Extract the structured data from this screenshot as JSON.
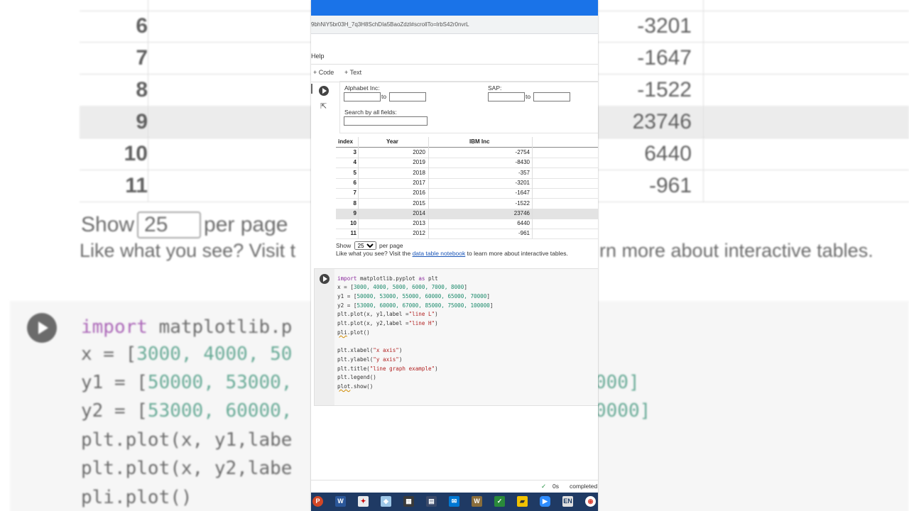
{
  "browser": {
    "url": "9bhNiY5br03H_7q3H8SchDIa5BaoZdzl#scrollTo=lrbS42r0nvrL"
  },
  "menu": {
    "help": "Help"
  },
  "toolbar": {
    "code_label": "+ Code",
    "text_label": "+ Text"
  },
  "filters": {
    "alphabet_label": "Alphabet Inc:",
    "sap_label": "SAP:",
    "to_label": "to",
    "search_label": "Search by all fields:",
    "alphabet_from": "",
    "alphabet_to": "",
    "sap_from": "",
    "sap_to": "",
    "search_value": ""
  },
  "table": {
    "headers": [
      "index",
      "Year",
      "IBM Inc"
    ],
    "rows": [
      {
        "index": "3",
        "year": "2020",
        "ibm": "-2754"
      },
      {
        "index": "4",
        "year": "2019",
        "ibm": "-8430"
      },
      {
        "index": "5",
        "year": "2018",
        "ibm": "-357"
      },
      {
        "index": "6",
        "year": "2017",
        "ibm": "-3201"
      },
      {
        "index": "7",
        "year": "2016",
        "ibm": "-1647"
      },
      {
        "index": "8",
        "year": "2015",
        "ibm": "-1522"
      },
      {
        "index": "9",
        "year": "2014",
        "ibm": "23746"
      },
      {
        "index": "10",
        "year": "2013",
        "ibm": "6440"
      },
      {
        "index": "11",
        "year": "2012",
        "ibm": "-961"
      }
    ]
  },
  "pagination": {
    "show": "Show",
    "per_page_value": "25",
    "per_page": "per page"
  },
  "info": {
    "prefix": "Like what you see? Visit the ",
    "link": "data table notebook",
    "suffix": " to learn more about interactive tables."
  },
  "code": {
    "l1_kw": "import",
    "l1_a": " matplotlib.pyplot ",
    "l1_kw2": "as",
    "l1_b": " plt",
    "l2_a": "x = [",
    "l2_n": "3000, 4000, 5000, 6000, 7000, 8000",
    "l2_b": "]",
    "l3_a": "y1 = [",
    "l3_n": "50000, 53000, 55000, 60000, 65000, 70000",
    "l3_b": "]",
    "l4_a": "y2 = [",
    "l4_n": "53000, 60000, 67000, 85000, 75000, 100000",
    "l4_b": "]",
    "l5_a": "plt.plot(x, y1,label =",
    "l5_s": "\"line L\"",
    "l5_b": ")",
    "l6_a": "plt.plot(x, y2,label =",
    "l6_s": "\"line H\"",
    "l6_b": ")",
    "l7_sq": "pli",
    "l7_b": ".plot()",
    "l8_a": "plt.xlabel(",
    "l8_s": "\"x axis\"",
    "l8_b": ")",
    "l9_a": "plt.ylabel(",
    "l9_s": "\"y axis\"",
    "l9_b": ")",
    "l10_a": "plt.title(",
    "l10_s": "\"line graph example\"",
    "l10_b": ")",
    "l11": "plt.legend()",
    "l12_sq": "plot",
    "l12_b": ".show()"
  },
  "status": {
    "time": "0s",
    "state": "completed"
  },
  "background": {
    "rows": [
      {
        "index": "6",
        "value": "-3201"
      },
      {
        "index": "7",
        "value": "-1647"
      },
      {
        "index": "8",
        "value": "-1522"
      },
      {
        "index": "9",
        "value": "23746"
      },
      {
        "index": "10",
        "value": "6440"
      },
      {
        "index": "11",
        "value": "-961"
      }
    ],
    "show": "Show",
    "per_page_value": "25",
    "per_page": "per page",
    "like_left": "Like what you see? Visit t",
    "like_right": "rn more about interactive tables.",
    "code_l1_kw": "import",
    "code_l1_b": " matplotlib.p",
    "code_l2_a": "x = [",
    "code_l2_n": "3000, 4000, 50",
    "code_l3_a": "y1 = [",
    "code_l3_n": "50000, 53000,",
    "code_l3_r": "000]",
    "code_l4_a": "y2 = [",
    "code_l4_n": "53000, 60000,",
    "code_l4_r": "0000]",
    "code_l5": "plt.plot(x, y1,labe",
    "code_l6": "plt.plot(x, y2,labe",
    "code_l7": "pli.plot()"
  }
}
